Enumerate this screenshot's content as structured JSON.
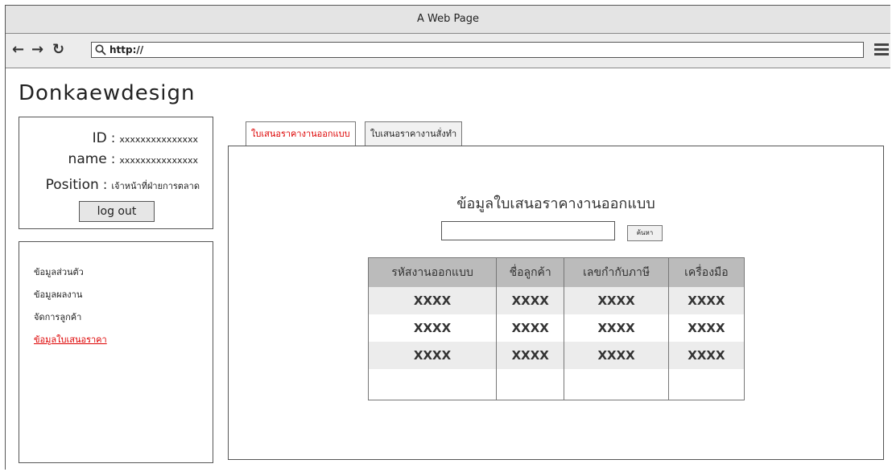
{
  "window": {
    "title": "A Web Page"
  },
  "browser": {
    "back_icon": "back-arrow-icon",
    "forward_icon": "forward-arrow-icon",
    "reload_icon": "reload-icon",
    "url": "http://",
    "menu_icon": "hamburger-menu-icon"
  },
  "site": {
    "title": "Donkaewdesign"
  },
  "user": {
    "id_label": "ID",
    "id_value": "xxxxxxxxxxxxxxx",
    "name_label": "name",
    "name_value": "xxxxxxxxxxxxxxx",
    "position_label": "Position",
    "position_value": "เจ้าหน้าที่ฝ่ายการตลาด",
    "separator": ":",
    "logout_label": "log out"
  },
  "sidebar": {
    "items": [
      {
        "label": "ข้อมูลส่วนตัว"
      },
      {
        "label": "ข้อมูลผลงาน"
      },
      {
        "label": "จัดการลูกค้า"
      },
      {
        "label": "ข้อมูลใบเสนอราคา",
        "active": true
      }
    ]
  },
  "tabs": [
    {
      "label": "ใบเสนอราคางานออกแบบ",
      "active": true
    },
    {
      "label": "ใบเสนอราคางานสั่งทำ"
    }
  ],
  "main": {
    "heading": "ข้อมูลใบเสนอราคางานออกแบบ",
    "search_value": "",
    "search_button_label": "ค้นหา",
    "table": {
      "columns": [
        "รหัสงานออกแบบ",
        "ชื่อลูกค้า",
        "เลขกำกับภาษี",
        "เครื่องมือ"
      ],
      "rows": [
        [
          "XXXX",
          "XXXX",
          "XXXX",
          "XXXX"
        ],
        [
          "XXXX",
          "XXXX",
          "XXXX",
          "XXXX"
        ],
        [
          "XXXX",
          "XXXX",
          "XXXX",
          "XXXX"
        ],
        [
          "",
          "",
          "",
          ""
        ]
      ]
    }
  },
  "colors": {
    "accent": "#dd0000",
    "header_bg": "#bbbbbb",
    "row_alt": "#ececec"
  }
}
